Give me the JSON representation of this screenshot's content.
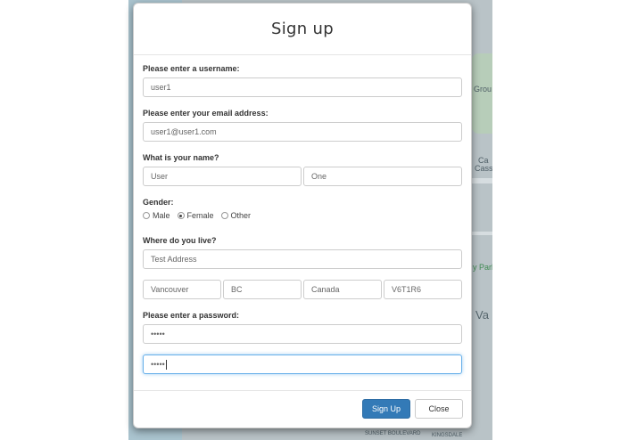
{
  "map": {
    "labels": [
      "Grou",
      "Ca",
      "Cassion B",
      "y Park",
      "Va"
    ],
    "footer_labels": [
      "SUNSET BOULEVARD",
      "KINGSDALE"
    ]
  },
  "modal": {
    "title": "Sign up",
    "username": {
      "label": "Please enter a username:",
      "value": "user1"
    },
    "email": {
      "label": "Please enter your email address:",
      "value": "user1@user1.com"
    },
    "name": {
      "label": "What is your name?",
      "first": "User",
      "last": "One"
    },
    "gender": {
      "label": "Gender:",
      "options": [
        "Male",
        "Female",
        "Other"
      ],
      "selected": "Female"
    },
    "address": {
      "label": "Where do you live?",
      "street": "Test Address",
      "city": "Vancouver",
      "province": "BC",
      "country": "Canada",
      "postal": "V6T1R6"
    },
    "password": {
      "label": "Please enter a password:",
      "value": "•••••",
      "confirm": "•••••"
    },
    "buttons": {
      "submit": "Sign Up",
      "close": "Close"
    }
  },
  "colors": {
    "primary": "#337ab7",
    "focus": "#66afe9"
  }
}
